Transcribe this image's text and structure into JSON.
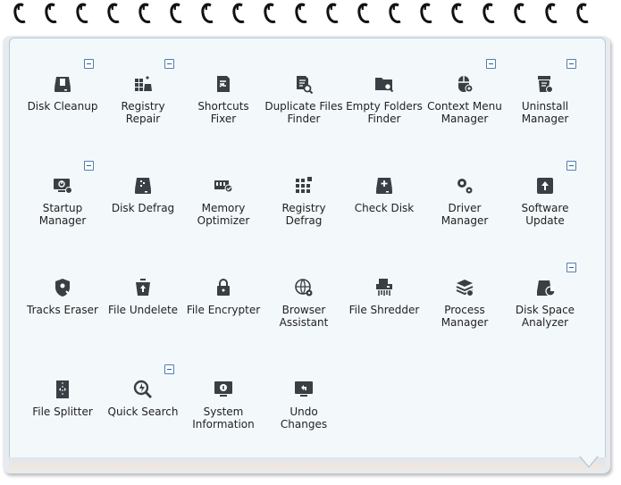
{
  "tools": [
    {
      "id": "disk-cleanup",
      "label": "Disk Cleanup",
      "icon": "disk-cleanup-icon",
      "collapse": true
    },
    {
      "id": "registry-repair",
      "label": "Registry\nRepair",
      "icon": "registry-repair-icon",
      "collapse": true
    },
    {
      "id": "shortcuts-fixer",
      "label": "Shortcuts\nFixer",
      "icon": "shortcuts-fixer-icon",
      "collapse": false
    },
    {
      "id": "duplicate-files-finder",
      "label": "Duplicate Files\nFinder",
      "icon": "duplicate-files-icon",
      "collapse": false
    },
    {
      "id": "empty-folders-finder",
      "label": "Empty Folders\nFinder",
      "icon": "empty-folders-icon",
      "collapse": false
    },
    {
      "id": "context-menu-manager",
      "label": "Context Menu\nManager",
      "icon": "context-menu-icon",
      "collapse": true
    },
    {
      "id": "uninstall-manager",
      "label": "Uninstall\nManager",
      "icon": "uninstall-icon",
      "collapse": true
    },
    {
      "id": "startup-manager",
      "label": "Startup\nManager",
      "icon": "startup-icon",
      "collapse": true
    },
    {
      "id": "disk-defrag",
      "label": "Disk Defrag",
      "icon": "disk-defrag-icon",
      "collapse": false
    },
    {
      "id": "memory-optimizer",
      "label": "Memory\nOptimizer",
      "icon": "memory-icon",
      "collapse": false
    },
    {
      "id": "registry-defrag",
      "label": "Registry\nDefrag",
      "icon": "registry-defrag-icon",
      "collapse": false
    },
    {
      "id": "check-disk",
      "label": "Check Disk",
      "icon": "check-disk-icon",
      "collapse": false
    },
    {
      "id": "driver-manager",
      "label": "Driver\nManager",
      "icon": "gears-icon",
      "collapse": false
    },
    {
      "id": "software-update",
      "label": "Software\nUpdate",
      "icon": "update-arrow-icon",
      "collapse": true
    },
    {
      "id": "tracks-eraser",
      "label": "Tracks Eraser",
      "icon": "shield-eraser-icon",
      "collapse": false
    },
    {
      "id": "file-undelete",
      "label": "File Undelete",
      "icon": "trash-restore-icon",
      "collapse": false
    },
    {
      "id": "file-encrypter",
      "label": "File Encrypter",
      "icon": "lock-icon",
      "collapse": false
    },
    {
      "id": "browser-assistant",
      "label": "Browser\nAssistant",
      "icon": "globe-gear-icon",
      "collapse": false
    },
    {
      "id": "file-shredder",
      "label": "File Shredder",
      "icon": "shredder-icon",
      "collapse": false
    },
    {
      "id": "process-manager",
      "label": "Process\nManager",
      "icon": "layers-gear-icon",
      "collapse": false
    },
    {
      "id": "disk-space-analyzer",
      "label": "Disk Space\nAnalyzer",
      "icon": "pie-disk-icon",
      "collapse": true
    },
    {
      "id": "file-splitter",
      "label": "File Splitter",
      "icon": "file-split-icon",
      "collapse": false
    },
    {
      "id": "quick-search",
      "label": "Quick Search",
      "icon": "lightning-search-icon",
      "collapse": true
    },
    {
      "id": "system-information",
      "label": "System\nInformation",
      "icon": "info-monitor-icon",
      "collapse": false
    },
    {
      "id": "undo-changes",
      "label": "Undo\nChanges",
      "icon": "undo-monitor-icon",
      "collapse": false
    }
  ],
  "colors": {
    "icon": "#3a3f45",
    "panel": "#f3f8fb",
    "border": "#b9c9d6",
    "collapse": "#4f7fb3"
  }
}
